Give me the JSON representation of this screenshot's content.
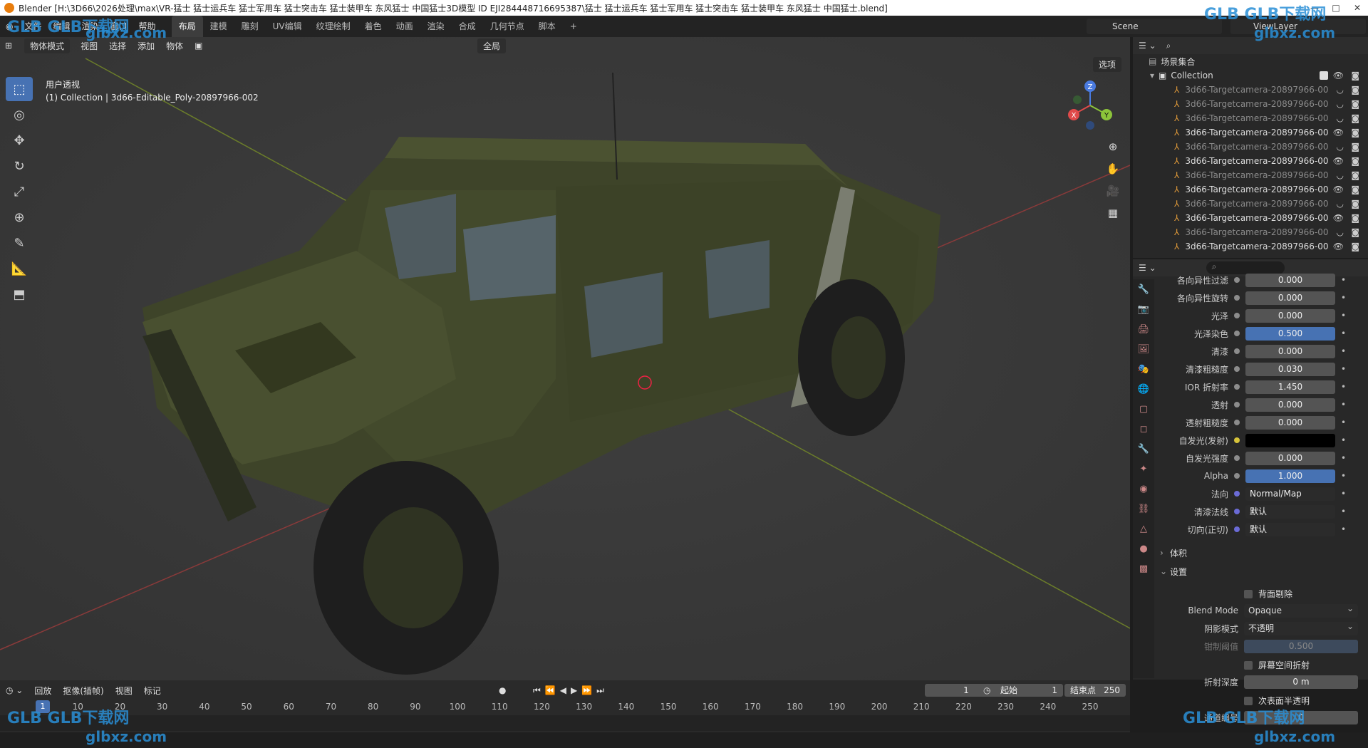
{
  "title_bar": {
    "title": "Blender [H:\\3D66\\2026处理\\max\\VR-猛士 猛士运兵车 猛士军用车 猛士突击车 猛士装甲车 东风猛士 中国猛士3D模型 ID EJI284448716695387\\猛士 猛士运兵车 猛士军用车 猛士突击车 猛士装甲车 东风猛士 中国猛士.blend]"
  },
  "menu": {
    "items": [
      "文件",
      "编辑",
      "渲染",
      "窗口",
      "帮助"
    ],
    "workspaces": [
      "布局",
      "建模",
      "雕刻",
      "UV编辑",
      "纹理绘制",
      "着色",
      "动画",
      "渲染",
      "合成",
      "几何节点",
      "脚本"
    ],
    "active_workspace": "布局",
    "add_tab": "+"
  },
  "scene": {
    "label": "Scene"
  },
  "view_layer": {
    "label": "ViewLayer"
  },
  "viewport_header": {
    "mode": "物体模式",
    "menus": [
      "视图",
      "选择",
      "添加",
      "物体"
    ],
    "transform": "全局",
    "options": "选项"
  },
  "viewport": {
    "view_name": "用户透视",
    "active_info": "(1) Collection | 3d66-Editable_Poly-20897966-002"
  },
  "gizmo": {
    "x": "X",
    "y": "Y",
    "z": "Z"
  },
  "outliner": {
    "root": "场景集合",
    "collection": "Collection",
    "items": [
      {
        "name": "3d66-Targetcamera-20897966-00",
        "dim": true
      },
      {
        "name": "3d66-Targetcamera-20897966-00",
        "dim": true
      },
      {
        "name": "3d66-Targetcamera-20897966-00",
        "dim": true
      },
      {
        "name": "3d66-Targetcamera-20897966-00",
        "dim": false
      },
      {
        "name": "3d66-Targetcamera-20897966-00",
        "dim": true
      },
      {
        "name": "3d66-Targetcamera-20897966-00",
        "dim": false
      },
      {
        "name": "3d66-Targetcamera-20897966-00",
        "dim": true
      },
      {
        "name": "3d66-Targetcamera-20897966-00",
        "dim": false
      },
      {
        "name": "3d66-Targetcamera-20897966-00",
        "dim": true
      },
      {
        "name": "3d66-Targetcamera-20897966-00",
        "dim": false
      },
      {
        "name": "3d66-Targetcamera-20897966-00",
        "dim": true
      },
      {
        "name": "3d66-Targetcamera-20897966-00",
        "dim": false
      }
    ]
  },
  "properties": {
    "rows": [
      {
        "label": "各向异性过滤",
        "value": "0.000"
      },
      {
        "label": "各向异性旋转",
        "value": "0.000"
      },
      {
        "label": "光泽",
        "value": "0.000"
      },
      {
        "label": "光泽染色",
        "value": "0.500",
        "style": "blue"
      },
      {
        "label": "清漆",
        "value": "0.000"
      },
      {
        "label": "清漆粗糙度",
        "value": "0.030"
      },
      {
        "label": "IOR 折射率",
        "value": "1.450"
      },
      {
        "label": "透射",
        "value": "0.000"
      },
      {
        "label": "透射粗糙度",
        "value": "0.000"
      },
      {
        "label": "自发光(发射)",
        "value": "",
        "style": "black"
      },
      {
        "label": "自发光强度",
        "value": "0.000"
      },
      {
        "label": "Alpha",
        "value": "1.000",
        "style": "blue"
      },
      {
        "label": "法向",
        "value": "Normal/Map",
        "style": "drop"
      },
      {
        "label": "清漆法线",
        "value": "默认",
        "style": "drop"
      },
      {
        "label": "切向(正切)",
        "value": "默认",
        "style": "drop"
      }
    ],
    "section_volume": "体积",
    "section_settings": "设置",
    "backface_culling": "背面剔除",
    "blend_mode_label": "Blend Mode",
    "blend_mode": "Opaque",
    "shadow_mode_label": "阴影模式",
    "shadow_mode": "不透明",
    "clip_label": "钳制阈值",
    "clip_value": "0.500",
    "screen_refraction": "屏幕空间折射",
    "refraction_depth_label": "折射深度",
    "refraction_depth": "0 m",
    "subsurface_translucency": "次表面半透明",
    "pass_index_label": "通道编号",
    "pass_index": "0"
  },
  "timeline": {
    "menus": [
      "回放",
      "抠像(插帧)",
      "视图",
      "标记"
    ],
    "current_frame": "1",
    "start_label": "起始",
    "start": "1",
    "end_label": "结束点",
    "end": "250",
    "ticks": [
      "1",
      "10",
      "20",
      "30",
      "40",
      "50",
      "60",
      "70",
      "80",
      "90",
      "100",
      "110",
      "120",
      "130",
      "140",
      "150",
      "160",
      "170",
      "180",
      "190",
      "200",
      "210",
      "220",
      "230",
      "240",
      "250"
    ]
  },
  "watermark": {
    "brand": "GLB下载网",
    "url": "glbxz.com",
    "logo": "GLB"
  },
  "colors": {
    "accent": "#4772b3",
    "vehicle": "#4a5232",
    "bg": "#3b3b3b"
  }
}
